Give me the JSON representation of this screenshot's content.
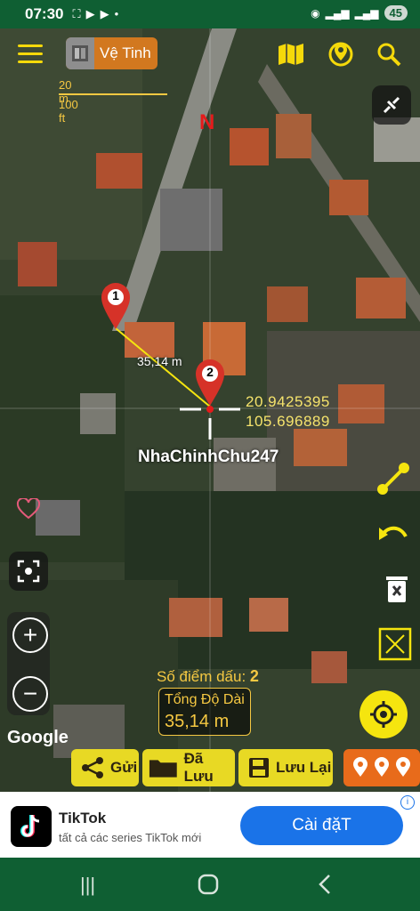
{
  "status_bar": {
    "time": "07:30",
    "battery": "45"
  },
  "toolbar": {
    "layer_label": "Vệ Tinh"
  },
  "scale": {
    "metric": "20 m",
    "imperial": "100 ft"
  },
  "compass": {
    "north": "N"
  },
  "markers": [
    {
      "label": "1"
    },
    {
      "label": "2"
    }
  ],
  "measurement": {
    "distance_label": "35,14 m",
    "latitude": "20.9425395",
    "longitude": "105.696889",
    "watermark": "NhaChinhChu247",
    "point_count_label": "Số điểm dấu:",
    "point_count": "2",
    "total_label": "Tổng Độ Dài",
    "total_value": "35,14 m"
  },
  "map_attribution": "Google",
  "bottom_actions": {
    "send": "Gửi",
    "saved": "Đã Lưu",
    "save": "Lưu Lại"
  },
  "ad": {
    "app_name": "TikTok",
    "description": "tất cả các series TikTok mới",
    "cta": "Cài đặT"
  },
  "colors": {
    "accent_yellow": "#f5d90a",
    "status_green": "#0f5f33",
    "orange": "#d2781f",
    "cta_blue": "#1a73e8"
  }
}
